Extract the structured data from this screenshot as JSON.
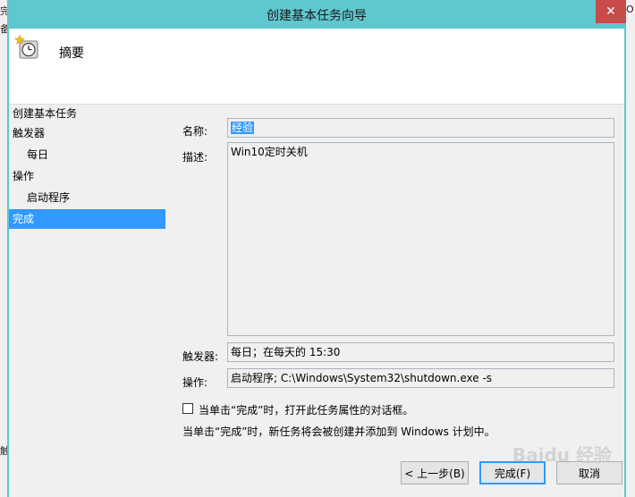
{
  "background": {
    "left_chars": [
      "完",
      "备",
      "",
      "触"
    ],
    "right_char": "O"
  },
  "window": {
    "title": "创建基本任务向导",
    "close_glyph": "✕"
  },
  "header": {
    "title": "摘要"
  },
  "nav": {
    "items": [
      {
        "label": "创建基本任务"
      },
      {
        "label": "触发器"
      },
      {
        "label": "每日"
      },
      {
        "label": "操作"
      },
      {
        "label": "启动程序"
      },
      {
        "label": "完成"
      }
    ]
  },
  "form": {
    "name_label": "名称:",
    "name_value": "经验",
    "desc_label": "描述:",
    "desc_value": "Win10定时关机",
    "trigger_label": "触发器:",
    "trigger_value": "每日；在每天的 15:30",
    "action_label": "操作:",
    "action_value": "启动程序; C:\\Windows\\System32\\shutdown.exe -s",
    "checkbox_label": "当单击“完成”时，打开此任务属性的对话框。",
    "checkbox_checked": false,
    "info_text": "当单击“完成”时，新任务将会被创建并添加到 Windows 计划中。"
  },
  "buttons": {
    "back": "< 上一步(B)",
    "finish": "完成(F)",
    "cancel": "取消"
  },
  "watermark": "Baidu 经验",
  "colors": {
    "titlebar": "#5fc7d0",
    "selection": "#3399ff",
    "close": "#c74b48"
  }
}
